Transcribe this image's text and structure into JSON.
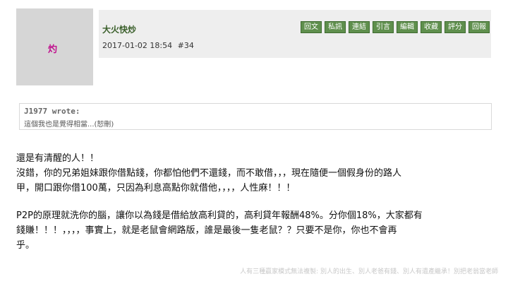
{
  "post": {
    "author": "大火快炒",
    "timestamp": "2017-01-02 18:54",
    "post_number": "#34",
    "avatar_glyph": "灼"
  },
  "actions": [
    "回文",
    "私訊",
    "連結",
    "引言",
    "編輯",
    "收藏",
    "評分",
    "回報"
  ],
  "quote": {
    "author": "J1977 wrote:",
    "text": "這個我也是覺得相當...(恕刪)"
  },
  "body": {
    "line1": "還是有清醒的人！！",
    "line2": "沒錯，你的兄弟姐妹跟你借點錢，你都怕他們不還錢，而不敢借，，，現在隨便一個假身份的路人",
    "line3": "甲，開口跟你借100萬，只因為利息高點你就借他，，，，人性麻！！！",
    "line4": "P2P的原理就洗你的腦，讓你以為錢是借給放高利貸的，高利貸年報酬48%。分你個18%，大家都有",
    "line5": "錢賺！！！，，，，事實上，就是老鼠會網路版，誰是最後一隻老鼠？？只要不是你，你也不會再",
    "line6": "乎。"
  },
  "signature": "人有三種贏家模式無法複製: 別人的出生、別人老爸有錢、別人有遺產繼承！別把老翁當老師"
}
